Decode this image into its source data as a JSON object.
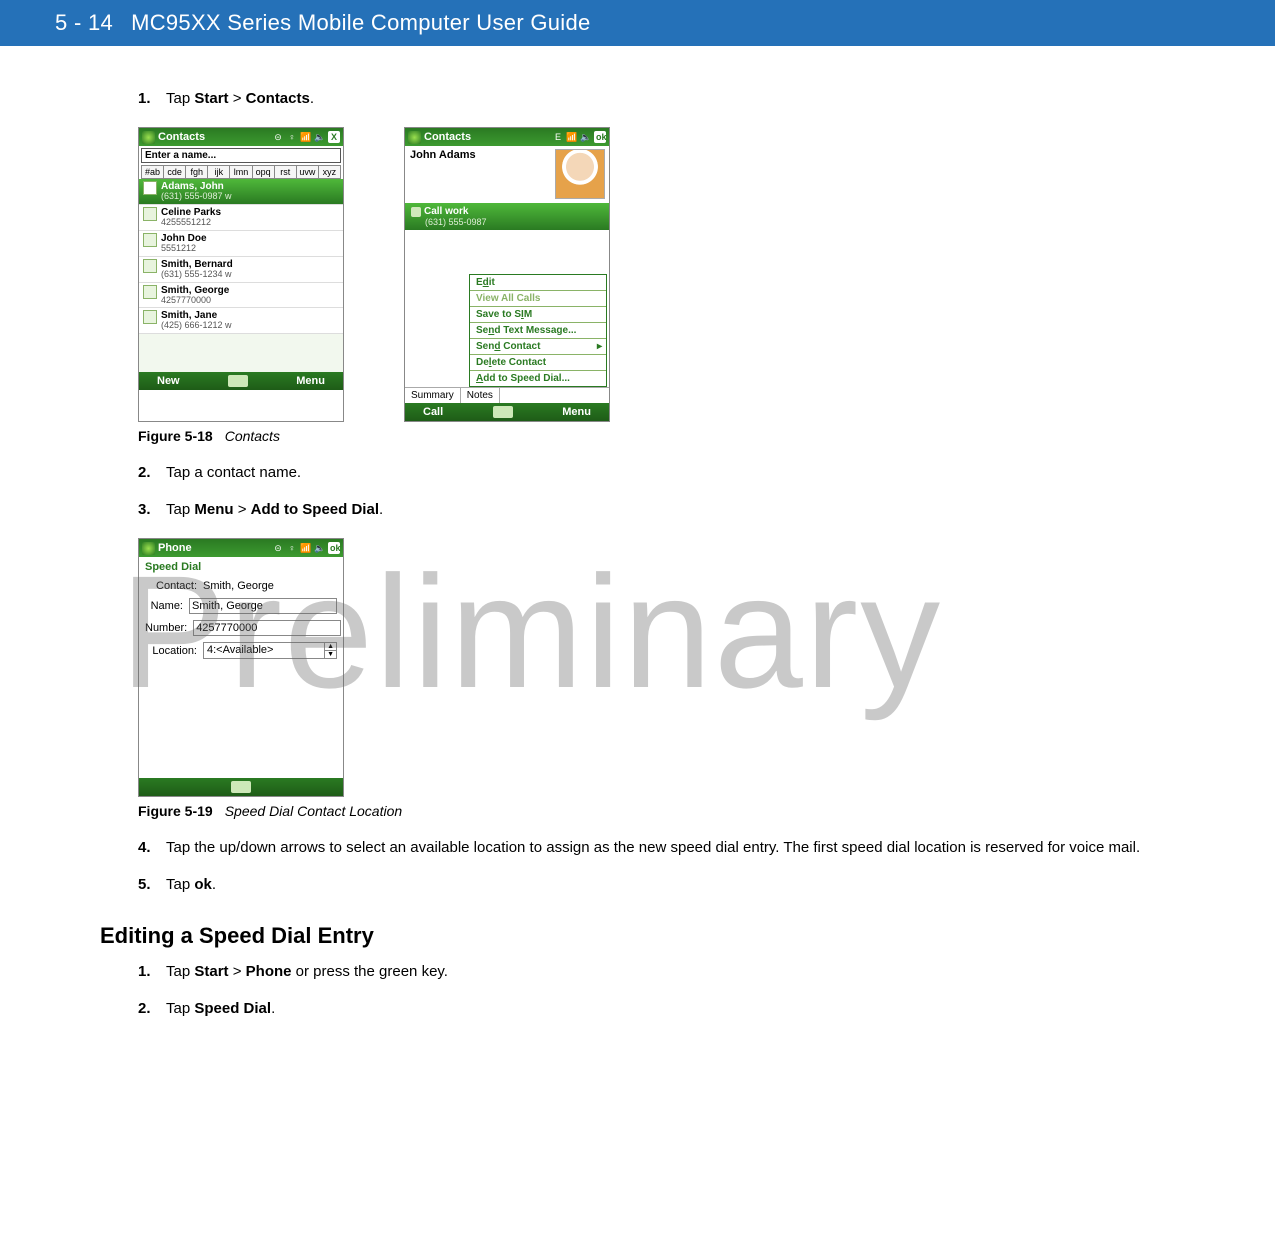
{
  "header": {
    "pagenum": "5 - 14",
    "title": "MC95XX Series Mobile Computer User Guide"
  },
  "watermark": "Preliminary",
  "stepsA": {
    "s1num": "1.",
    "s1a": "Tap ",
    "s1b": "Start",
    "s1c": " > ",
    "s1d": "Contacts",
    "s1e": "."
  },
  "fig18": {
    "num": "Figure 5-18",
    "title": "Contacts"
  },
  "shotA": {
    "title": "Contacts",
    "close": "X",
    "enter": "Enter a name...",
    "tabs": [
      "#ab",
      "cde",
      "fgh",
      "ijk",
      "lmn",
      "opq",
      "rst",
      "uvw",
      "xyz"
    ],
    "rows": [
      {
        "name": "Adams, John",
        "phone": "(631) 555-0987   w",
        "sel": true
      },
      {
        "name": "Celine Parks",
        "phone": "4255551212",
        "sel": false
      },
      {
        "name": "John Doe",
        "phone": "5551212",
        "sel": false
      },
      {
        "name": "Smith, Bernard",
        "phone": "(631) 555-1234   w",
        "sel": false
      },
      {
        "name": "Smith, George",
        "phone": "4257770000",
        "sel": false
      },
      {
        "name": "Smith, Jane",
        "phone": "(425) 666-1212   w",
        "sel": false
      }
    ],
    "softLeft": "New",
    "softRight": "Menu"
  },
  "shotB": {
    "title": "Contacts",
    "ok": "ok",
    "name": "John Adams",
    "callwork_label": "Call work",
    "callwork_phone": "(631) 555-0987",
    "menu": {
      "edit_pre": "E",
      "edit_u": "d",
      "edit_post": "it",
      "view": "View All Calls",
      "sim_pre": "Save to S",
      "sim_u": "I",
      "sim_post": "M",
      "txt_pre": "Se",
      "txt_u": "n",
      "txt_post": "d Text Message...",
      "send_pre": "Sen",
      "send_u": "d",
      "send_post": " Contact",
      "del_pre": "De",
      "del_u": "l",
      "del_post": "ete Contact",
      "add_pre": "",
      "add_u": "A",
      "add_post": "dd to Speed Dial..."
    },
    "tabSummary": "Summary",
    "tabNotes": "Notes",
    "softLeft": "Call",
    "softRight": "Menu"
  },
  "stepsB": {
    "s2num": "2.",
    "s2": "Tap a contact name.",
    "s3num": "3.",
    "s3a": "Tap ",
    "s3b": "Menu",
    "s3c": " > ",
    "s3d": "Add to Speed Dial",
    "s3e": "."
  },
  "shotC": {
    "title": "Phone",
    "ok": "ok",
    "heading": "Speed Dial",
    "contact_lbl": "Contact:",
    "contact_val": "Smith, George",
    "name_lbl": "Name:",
    "name_val": "Smith, George",
    "number_lbl": "Number:",
    "number_val": "4257770000",
    "location_lbl": "Location:",
    "location_val": "4:<Available>",
    "up": "▲",
    "down": "▼"
  },
  "fig19": {
    "num": "Figure 5-19",
    "title": "Speed Dial Contact Location"
  },
  "stepsC": {
    "s4num": "4.",
    "s4": "Tap the up/down arrows to select an available location to assign as the new speed dial entry. The first speed dial location is reserved for voice mail.",
    "s5num": "5.",
    "s5a": "Tap ",
    "s5b": "ok",
    "s5c": "."
  },
  "section2": "Editing a Speed Dial Entry",
  "stepsD": {
    "s1num": "1.",
    "s1a": "Tap ",
    "s1b": "Start",
    "s1c": " > ",
    "s1d": "Phone",
    "s1e": " or press the green key.",
    "s2num": "2.",
    "s2a": "Tap ",
    "s2b": "Speed Dial",
    "s2c": "."
  }
}
